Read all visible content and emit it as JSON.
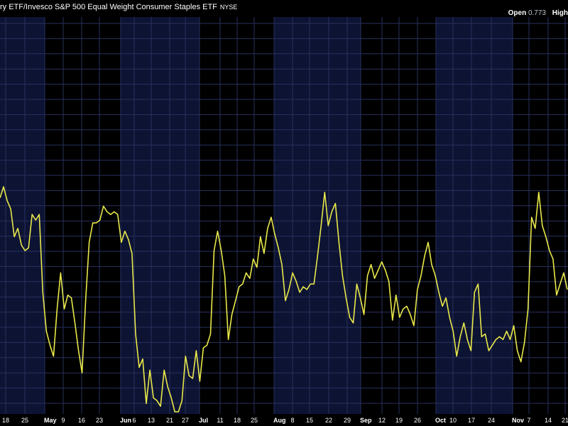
{
  "header": {
    "title": "ry ETF/Invesco S&P 500 Equal Weight Consumer Staples ETF",
    "exchange": "NYSE",
    "open_label": "Open",
    "open_value": "0.773",
    "high_label": "High"
  },
  "colors": {
    "background": "#000000",
    "band_light": "#0d1333",
    "band_dark": "#000000",
    "grid": "#28315e",
    "line": "#e8e84a",
    "text": "#ffffff"
  },
  "chart_data": {
    "type": "line",
    "title": "",
    "xlabel": "",
    "ylabel": "",
    "x_tick_labels": [
      "18",
      "25",
      "May",
      "9",
      "16",
      "23",
      "Jun",
      "6",
      "13",
      "21",
      "27",
      "Jul",
      "11",
      "18",
      "25",
      "Aug",
      "8",
      "15",
      "22",
      "29",
      "Sep",
      "12",
      "19",
      "26",
      "Oct",
      "10",
      "17",
      "24",
      "Nov",
      "7",
      "14",
      "21"
    ],
    "month_labels": [
      "May",
      "Jun",
      "Jul",
      "Aug",
      "Sep",
      "Oct",
      "Nov"
    ],
    "grid": true,
    "series": [
      {
        "values": [
          0.802,
          0.806,
          0.801,
          0.798,
          0.788,
          0.791,
          0.785,
          0.783,
          0.784,
          0.796,
          0.794,
          0.796,
          0.768,
          0.754,
          0.749,
          0.745,
          0.762,
          0.775,
          0.762,
          0.767,
          0.766,
          0.757,
          0.747,
          0.739,
          0.765,
          0.786,
          0.793,
          0.793,
          0.794,
          0.799,
          0.797,
          0.796,
          0.797,
          0.796,
          0.786,
          0.79,
          0.787,
          0.782,
          0.753,
          0.741,
          0.744,
          0.728,
          0.74,
          0.73,
          0.729,
          0.727,
          0.74,
          0.734,
          0.73,
          0.725,
          0.725,
          0.729,
          0.745,
          0.738,
          0.737,
          0.747,
          0.736,
          0.748,
          0.749,
          0.753,
          0.783,
          0.79,
          0.783,
          0.774,
          0.751,
          0.76,
          0.765,
          0.77,
          0.771,
          0.775,
          0.773,
          0.78,
          0.777,
          0.788,
          0.782,
          0.791,
          0.795,
          0.789,
          0.784,
          0.778,
          0.765,
          0.769,
          0.775,
          0.772,
          0.768,
          0.77,
          0.769,
          0.771,
          0.771,
          0.781,
          0.792,
          0.804,
          0.792,
          0.797,
          0.8,
          0.786,
          0.774,
          0.766,
          0.759,
          0.757,
          0.771,
          0.766,
          0.76,
          0.774,
          0.778,
          0.773,
          0.776,
          0.779,
          0.776,
          0.772,
          0.758,
          0.767,
          0.759,
          0.762,
          0.763,
          0.76,
          0.756,
          0.769,
          0.774,
          0.781,
          0.786,
          0.778,
          0.774,
          0.768,
          0.763,
          0.766,
          0.759,
          0.754,
          0.745,
          0.752,
          0.757,
          0.751,
          0.747,
          0.768,
          0.771,
          0.752,
          0.753,
          0.747,
          0.749,
          0.751,
          0.752,
          0.751,
          0.754,
          0.751,
          0.756,
          0.747,
          0.743,
          0.75,
          0.762,
          0.795,
          0.791,
          0.804,
          0.792,
          0.788,
          0.783,
          0.78,
          0.767,
          0.771,
          0.775,
          0.769
        ]
      }
    ]
  }
}
